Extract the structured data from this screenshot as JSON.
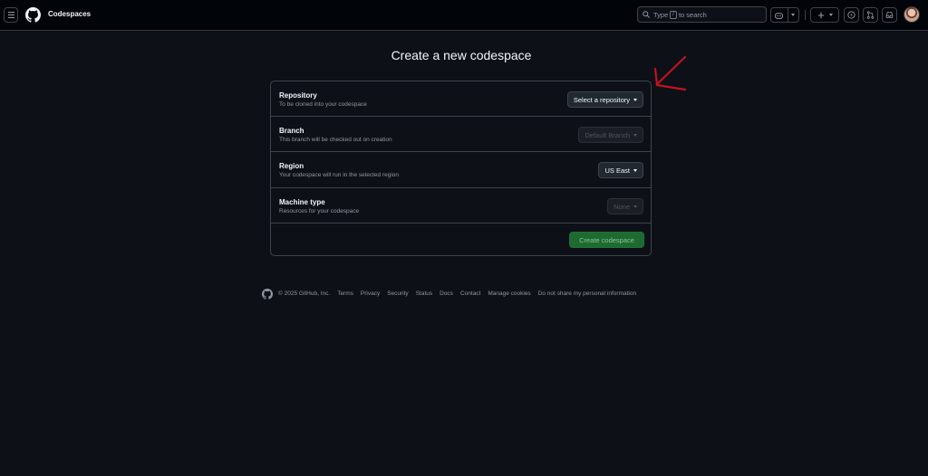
{
  "header": {
    "app_title": "Codespaces",
    "search_prefix": "Type",
    "search_key": "/",
    "search_suffix": "to search",
    "icons": [
      "menu-icon",
      "github-logo-icon",
      "search-icon",
      "copilot-icon",
      "plus-icon",
      "issues-icon",
      "pull-requests-icon",
      "inbox-icon",
      "avatar"
    ]
  },
  "main": {
    "title": "Create a new codespace",
    "rows": [
      {
        "label": "Repository",
        "description": "To be cloned into your codespace",
        "value": "Select a repository"
      },
      {
        "label": "Branch",
        "description": "This branch will be checked out on creation",
        "value": "Default Branch"
      },
      {
        "label": "Region",
        "description": "Your codespace will run in the selected region",
        "value": "US East"
      },
      {
        "label": "Machine type",
        "description": "Resources for your codespace",
        "value": "None"
      }
    ],
    "create_label": "Create codespace"
  },
  "footer": {
    "copyright": "© 2025 GitHub, Inc.",
    "links": [
      "Terms",
      "Privacy",
      "Security",
      "Status",
      "Docs",
      "Contact",
      "Manage cookies",
      "Do not share my personal information"
    ]
  },
  "colors": {
    "background": "#0d1117",
    "header_bg": "#010409",
    "border": "#3d444d",
    "create_button": "#1d6b31",
    "annotation_arrow": "#c1121f"
  }
}
